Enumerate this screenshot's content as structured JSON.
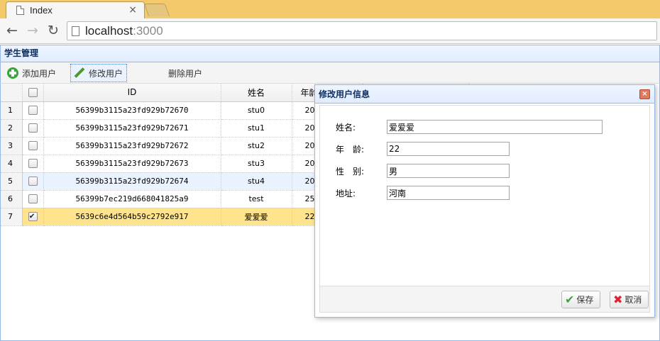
{
  "browser": {
    "tab_title": "Index",
    "tab_close": "×",
    "url_host": "localhost",
    "url_port": ":3000"
  },
  "panel": {
    "title": "学生管理"
  },
  "toolbar": {
    "add_label": "添加用户",
    "edit_label": "修改用户",
    "delete_label": "删除用户"
  },
  "grid": {
    "columns": [
      "ID",
      "姓名",
      "年龄"
    ],
    "rows": [
      {
        "num": "1",
        "id": "56399b3115a23fd929b72670",
        "name": "stu0",
        "age": "20",
        "checked": false
      },
      {
        "num": "2",
        "id": "56399b3115a23fd929b72671",
        "name": "stu1",
        "age": "20",
        "checked": false
      },
      {
        "num": "3",
        "id": "56399b3115a23fd929b72672",
        "name": "stu2",
        "age": "20",
        "checked": false
      },
      {
        "num": "4",
        "id": "56399b3115a23fd929b72673",
        "name": "stu3",
        "age": "20",
        "checked": false
      },
      {
        "num": "5",
        "id": "56399b3115a23fd929b72674",
        "name": "stu4",
        "age": "20",
        "checked": false
      },
      {
        "num": "6",
        "id": "56399b7ec219d668041825a9",
        "name": "test",
        "age": "25",
        "checked": false
      },
      {
        "num": "7",
        "id": "5639c6e4d564b59c2792e917",
        "name": "爱爱爱",
        "age": "22",
        "checked": true
      }
    ]
  },
  "dialog": {
    "title": "修改用户信息",
    "close": "×",
    "fields": {
      "name_label": "姓名:",
      "name_value": "爱爱爱",
      "age_label": "年　龄:",
      "age_value": "22",
      "gender_label": "性　别:",
      "gender_value": "男",
      "address_label": "地址:",
      "address_value": "河南"
    },
    "save_label": "保存",
    "cancel_label": "取消"
  },
  "colors": {
    "panel_border": "#95b8e7",
    "selected_row": "#ffe48d",
    "hover_row": "#eaf2ff",
    "tabstrip": "#f4c96b"
  }
}
